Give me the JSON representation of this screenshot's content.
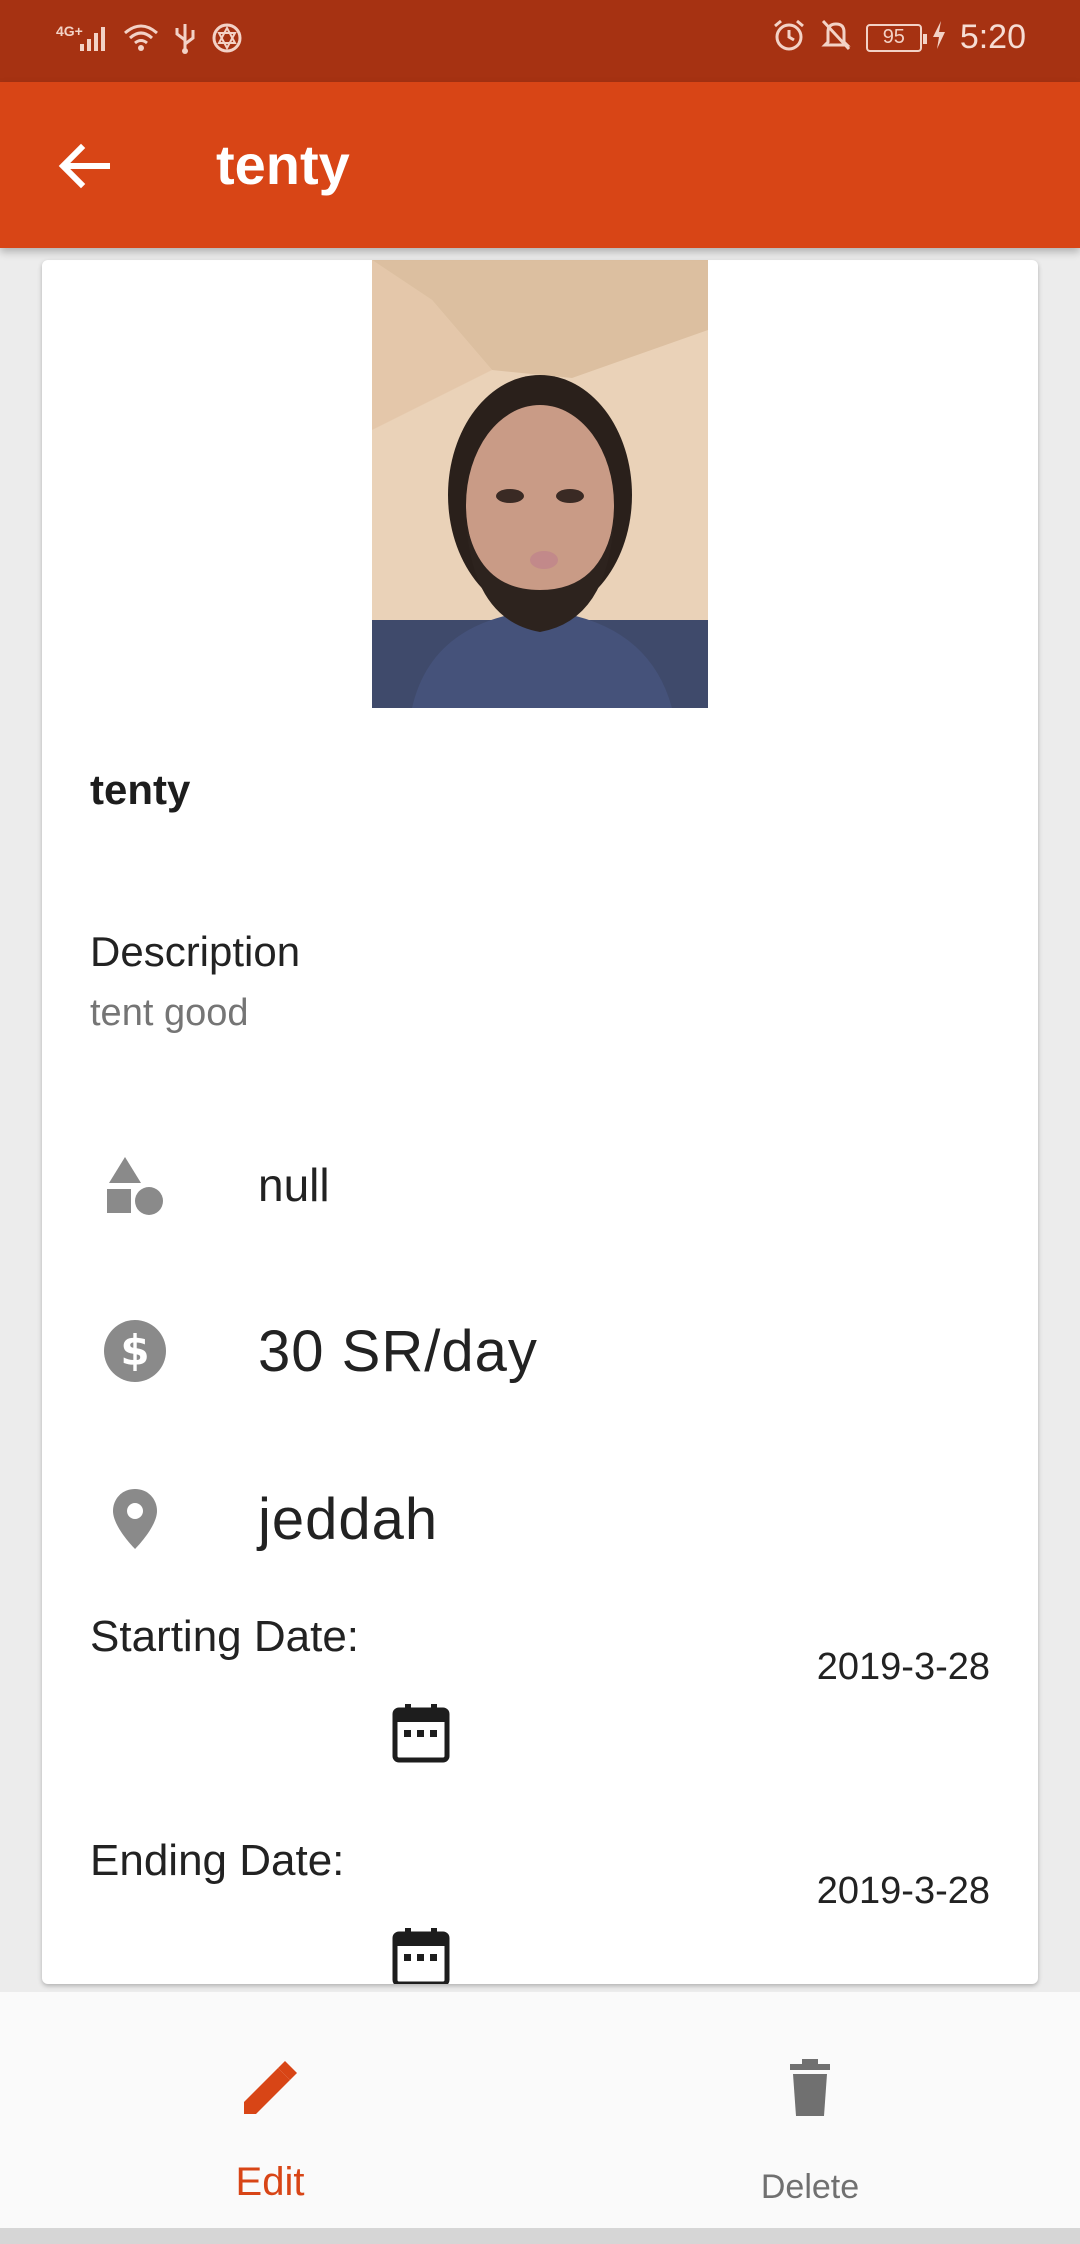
{
  "status_bar": {
    "network": "4G+",
    "battery": "95",
    "time": "5:20",
    "icons": [
      "signal-icon",
      "wifi-icon",
      "usb-icon",
      "app-icon",
      "alarm-icon",
      "mute-icon",
      "battery-icon",
      "charging-icon"
    ]
  },
  "app_bar": {
    "title": "tenty",
    "back_icon": "arrow-back-icon"
  },
  "item": {
    "name": "tenty",
    "description_label": "Description",
    "description": "tent good",
    "category": "null",
    "price": "30 SR/day",
    "location": "jeddah",
    "starting_date_label": "Starting Date:",
    "starting_date": "2019-3-28",
    "ending_date_label": "Ending  Date:",
    "ending_date": "2019-3-28"
  },
  "bottom_nav": {
    "edit_label": "Edit",
    "delete_label": "Delete"
  },
  "colors": {
    "status_bar": "#a63212",
    "app_bar": "#d84516",
    "accent": "#d84516",
    "icon_grey": "#8a8a8a"
  }
}
